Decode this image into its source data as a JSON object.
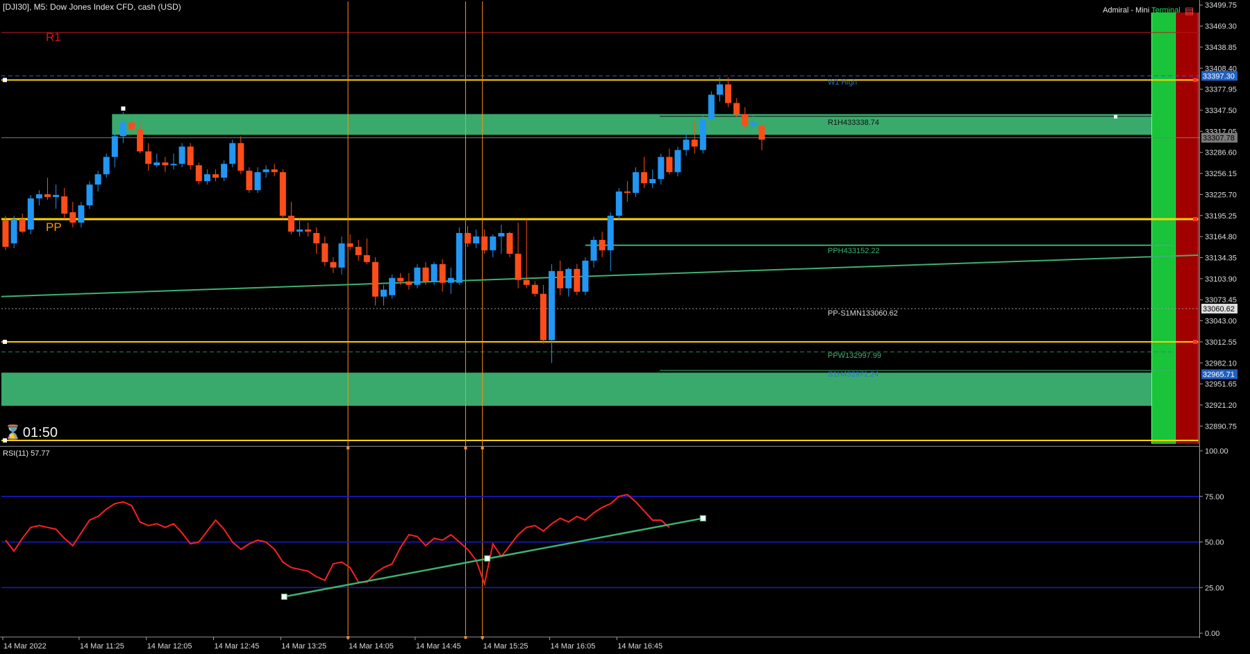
{
  "header": {
    "symbol_info": "[DJI30], M5:  Dow Jones Index CFD, cash (USD)",
    "brand_label": "Admiral - Mini ",
    "brand_terminal": "Terminal",
    "brand_icon": "chart-icon"
  },
  "timer": {
    "icon": "hourglass-icon",
    "glyph": "⌛",
    "value": "01:50"
  },
  "colors": {
    "background": "#000000",
    "bull": "#2196f3",
    "bear": "#ff4d1a",
    "zone": "#3cb371",
    "level_yellow": "#ffd400",
    "level_r1": "#c01818",
    "rsi_line": "#ff2020",
    "rsi_level": "#1a1adc",
    "trend": "#3cb371",
    "vline": "#ff9020"
  },
  "chart_data": [
    {
      "type": "candlestick",
      "symbol": "DJI30",
      "timeframe": "M5",
      "ylim": [
        32865,
        33505
      ],
      "y_ticks": [
        33499.75,
        33469.3,
        33438.85,
        33408.4,
        33377.95,
        33347.5,
        33317.05,
        33286.6,
        33256.15,
        33225.7,
        33195.25,
        33164.8,
        33134.35,
        33103.9,
        33073.45,
        33043.0,
        33012.55,
        32982.1,
        32951.65,
        32921.2,
        32890.75
      ],
      "y_tick_labels": [
        "33499.75",
        "33469.30",
        "33438.85",
        "33408.40",
        "33377.95",
        "33347.50",
        "33317.05",
        "33286.60",
        "33256.15",
        "33225.70",
        "33195.25",
        "33164.80",
        "33134.35",
        "33103.90",
        "33073.45",
        "33043.00",
        "33012.55",
        "32982.10",
        "32951.65",
        "32921.20",
        "32890.75"
      ],
      "x_labels": [
        {
          "label": "14 Mar 2022",
          "bar": 0
        },
        {
          "label": "14 Mar 11:25",
          "bar": 9
        },
        {
          "label": "14 Mar 12:05",
          "bar": 17
        },
        {
          "label": "14 Mar 12:45",
          "bar": 25
        },
        {
          "label": "14 Mar 13:25",
          "bar": 33
        },
        {
          "label": "14 Mar 14:05",
          "bar": 41
        },
        {
          "label": "14 Mar 14:45",
          "bar": 49
        },
        {
          "label": "14 Mar 15:25",
          "bar": 57
        },
        {
          "label": "14 Mar 16:05",
          "bar": 65
        },
        {
          "label": "14 Mar 16:45",
          "bar": 73
        }
      ],
      "total_bars": 115,
      "candles": [
        {
          "o": 33188,
          "h": 33195,
          "l": 33145,
          "c": 33150
        },
        {
          "o": 33155,
          "h": 33195,
          "l": 33148,
          "c": 33190
        },
        {
          "o": 33190,
          "h": 33198,
          "l": 33170,
          "c": 33172
        },
        {
          "o": 33175,
          "h": 33225,
          "l": 33168,
          "c": 33220
        },
        {
          "o": 33220,
          "h": 33232,
          "l": 33210,
          "c": 33226
        },
        {
          "o": 33226,
          "h": 33250,
          "l": 33218,
          "c": 33222
        },
        {
          "o": 33222,
          "h": 33240,
          "l": 33205,
          "c": 33225
        },
        {
          "o": 33223,
          "h": 33235,
          "l": 33190,
          "c": 33198
        },
        {
          "o": 33200,
          "h": 33215,
          "l": 33178,
          "c": 33185
        },
        {
          "o": 33185,
          "h": 33215,
          "l": 33178,
          "c": 33210
        },
        {
          "o": 33210,
          "h": 33245,
          "l": 33205,
          "c": 33240
        },
        {
          "o": 33240,
          "h": 33260,
          "l": 33230,
          "c": 33255
        },
        {
          "o": 33255,
          "h": 33285,
          "l": 33250,
          "c": 33280
        },
        {
          "o": 33280,
          "h": 33320,
          "l": 33265,
          "c": 33310
        },
        {
          "o": 33310,
          "h": 33345,
          "l": 33300,
          "c": 33330
        },
        {
          "o": 33330,
          "h": 33340,
          "l": 33315,
          "c": 33320
        },
        {
          "o": 33320,
          "h": 33330,
          "l": 33285,
          "c": 33288
        },
        {
          "o": 33288,
          "h": 33300,
          "l": 33260,
          "c": 33270
        },
        {
          "o": 33268,
          "h": 33285,
          "l": 33265,
          "c": 33272
        },
        {
          "o": 33272,
          "h": 33280,
          "l": 33258,
          "c": 33268
        },
        {
          "o": 33268,
          "h": 33285,
          "l": 33262,
          "c": 33270
        },
        {
          "o": 33270,
          "h": 33300,
          "l": 33265,
          "c": 33295
        },
        {
          "o": 33295,
          "h": 33300,
          "l": 33262,
          "c": 33268
        },
        {
          "o": 33268,
          "h": 33272,
          "l": 33240,
          "c": 33245
        },
        {
          "o": 33245,
          "h": 33262,
          "l": 33240,
          "c": 33255
        },
        {
          "o": 33255,
          "h": 33262,
          "l": 33245,
          "c": 33250
        },
        {
          "o": 33250,
          "h": 33275,
          "l": 33245,
          "c": 33270
        },
        {
          "o": 33270,
          "h": 33305,
          "l": 33265,
          "c": 33300
        },
        {
          "o": 33300,
          "h": 33310,
          "l": 33255,
          "c": 33260
        },
        {
          "o": 33260,
          "h": 33265,
          "l": 33228,
          "c": 33232
        },
        {
          "o": 33232,
          "h": 33265,
          "l": 33228,
          "c": 33258
        },
        {
          "o": 33258,
          "h": 33268,
          "l": 33250,
          "c": 33262
        },
        {
          "o": 33262,
          "h": 33270,
          "l": 33252,
          "c": 33258
        },
        {
          "o": 33258,
          "h": 33262,
          "l": 33190,
          "c": 33195
        },
        {
          "o": 33195,
          "h": 33215,
          "l": 33168,
          "c": 33172
        },
        {
          "o": 33172,
          "h": 33190,
          "l": 33165,
          "c": 33175
        },
        {
          "o": 33175,
          "h": 33185,
          "l": 33165,
          "c": 33172
        },
        {
          "o": 33170,
          "h": 33178,
          "l": 33140,
          "c": 33155
        },
        {
          "o": 33155,
          "h": 33165,
          "l": 33122,
          "c": 33128
        },
        {
          "o": 33128,
          "h": 33135,
          "l": 33112,
          "c": 33120
        },
        {
          "o": 33120,
          "h": 33165,
          "l": 33110,
          "c": 33155
        },
        {
          "o": 33155,
          "h": 33168,
          "l": 33145,
          "c": 33150
        },
        {
          "o": 33150,
          "h": 33160,
          "l": 33130,
          "c": 33138
        },
        {
          "o": 33138,
          "h": 33162,
          "l": 33125,
          "c": 33128
        },
        {
          "o": 33128,
          "h": 33135,
          "l": 33065,
          "c": 33078
        },
        {
          "o": 33078,
          "h": 33095,
          "l": 33065,
          "c": 33088
        },
        {
          "o": 33080,
          "h": 33110,
          "l": 33075,
          "c": 33105
        },
        {
          "o": 33105,
          "h": 33112,
          "l": 33095,
          "c": 33100
        },
        {
          "o": 33100,
          "h": 33112,
          "l": 33088,
          "c": 33095
        },
        {
          "o": 33095,
          "h": 33125,
          "l": 33090,
          "c": 33120
        },
        {
          "o": 33120,
          "h": 33128,
          "l": 33095,
          "c": 33100
        },
        {
          "o": 33100,
          "h": 33128,
          "l": 33095,
          "c": 33125
        },
        {
          "o": 33125,
          "h": 33132,
          "l": 33085,
          "c": 33098
        },
        {
          "o": 33098,
          "h": 33120,
          "l": 33082,
          "c": 33105
        },
        {
          "o": 33098,
          "h": 33178,
          "l": 33095,
          "c": 33170
        },
        {
          "o": 33170,
          "h": 33180,
          "l": 33150,
          "c": 33155
        },
        {
          "o": 33155,
          "h": 33175,
          "l": 33148,
          "c": 33165
        },
        {
          "o": 33165,
          "h": 33175,
          "l": 33140,
          "c": 33145
        },
        {
          "o": 33145,
          "h": 33168,
          "l": 33135,
          "c": 33165
        },
        {
          "o": 33165,
          "h": 33182,
          "l": 33140,
          "c": 33170
        },
        {
          "o": 33170,
          "h": 33172,
          "l": 33135,
          "c": 33140
        },
        {
          "o": 33140,
          "h": 33185,
          "l": 33090,
          "c": 33102
        },
        {
          "o": 33102,
          "h": 33190,
          "l": 33090,
          "c": 33095
        },
        {
          "o": 33095,
          "h": 33100,
          "l": 33078,
          "c": 33082
        },
        {
          "o": 33082,
          "h": 33095,
          "l": 33010,
          "c": 33015
        },
        {
          "o": 33015,
          "h": 33125,
          "l": 32982,
          "c": 33115
        },
        {
          "o": 33115,
          "h": 33130,
          "l": 33080,
          "c": 33090
        },
        {
          "o": 33090,
          "h": 33120,
          "l": 33078,
          "c": 33118
        },
        {
          "o": 33118,
          "h": 33125,
          "l": 33080,
          "c": 33085
        },
        {
          "o": 33085,
          "h": 33135,
          "l": 33080,
          "c": 33130
        },
        {
          "o": 33130,
          "h": 33165,
          "l": 33120,
          "c": 33160
        },
        {
          "o": 33160,
          "h": 33172,
          "l": 33135,
          "c": 33145
        },
        {
          "o": 33145,
          "h": 33200,
          "l": 33115,
          "c": 33195
        },
        {
          "o": 33195,
          "h": 33235,
          "l": 33188,
          "c": 33230
        },
        {
          "o": 33230,
          "h": 33245,
          "l": 33215,
          "c": 33228
        },
        {
          "o": 33228,
          "h": 33265,
          "l": 33222,
          "c": 33258
        },
        {
          "o": 33258,
          "h": 33280,
          "l": 33235,
          "c": 33242
        },
        {
          "o": 33242,
          "h": 33262,
          "l": 33235,
          "c": 33248
        },
        {
          "o": 33248,
          "h": 33285,
          "l": 33240,
          "c": 33280
        },
        {
          "o": 33280,
          "h": 33292,
          "l": 33255,
          "c": 33258
        },
        {
          "o": 33258,
          "h": 33295,
          "l": 33252,
          "c": 33290
        },
        {
          "o": 33290,
          "h": 33315,
          "l": 33282,
          "c": 33305
        },
        {
          "o": 33305,
          "h": 33330,
          "l": 33285,
          "c": 33295
        },
        {
          "o": 33290,
          "h": 33340,
          "l": 33285,
          "c": 33335
        },
        {
          "o": 33335,
          "h": 33375,
          "l": 33330,
          "c": 33370
        },
        {
          "o": 33370,
          "h": 33395,
          "l": 33360,
          "c": 33385
        },
        {
          "o": 33385,
          "h": 33395,
          "l": 33352,
          "c": 33358
        },
        {
          "o": 33358,
          "h": 33365,
          "l": 33338,
          "c": 33342
        },
        {
          "o": 33342,
          "h": 33352,
          "l": 33318,
          "c": 33325
        },
        {
          "o": 33325,
          "h": 33340,
          "l": 33322,
          "c": 33330
        },
        {
          "o": 33325,
          "h": 33330,
          "l": 33290,
          "c": 33305
        }
      ],
      "levels": [
        {
          "name": "R1",
          "price": 33460,
          "label": "R1"
        },
        {
          "name": "W1 High",
          "price": 33397.3,
          "label": "W1 High",
          "badge": "33397.30"
        },
        {
          "name": "PP",
          "price": 33190,
          "label": "PP"
        },
        {
          "name": "R1H4",
          "price": 33338.74,
          "label": "R1H433338.74"
        },
        {
          "name": "PPH4",
          "price": 33152.22,
          "label": "PPH433152.22"
        },
        {
          "name": "PP-S1MN1",
          "price": 33060.62,
          "label": "PP-S1MN133060.62",
          "badge": "33060.62"
        },
        {
          "name": "PPW1",
          "price": 32997.99,
          "label": "PPW132997.99"
        },
        {
          "name": "S1H4",
          "price": 32971.24,
          "label": "S1H432971.24",
          "badge": "32965.71"
        },
        {
          "name": "current",
          "price": 33307.78,
          "badge": "33307.78"
        },
        {
          "name": "yellow_low",
          "price": 33012.55
        },
        {
          "name": "yellow_bottom",
          "price": 32870
        }
      ],
      "zones": [
        {
          "from_bar": 13,
          "top": 33342,
          "bottom": 33312
        },
        {
          "from_bar": 0,
          "top": 32968,
          "bottom": 32920
        }
      ],
      "trendline": {
        "bar1": 0,
        "p1": 33078,
        "bar2": 115,
        "p2": 33138
      },
      "vlines_bars": [
        41,
        55,
        57
      ]
    },
    {
      "type": "line",
      "title": "RSI(11) 57.77",
      "period": 11,
      "current": 57.77,
      "ylim": [
        0,
        100
      ],
      "y_ticks": [
        100,
        75,
        50,
        25,
        0
      ],
      "y_tick_labels": [
        "100.00",
        "75.00",
        "50.00",
        "25.00",
        "0.00"
      ],
      "levels": [
        75,
        50,
        25
      ],
      "values": [
        51,
        45,
        52,
        58,
        59,
        58,
        57,
        52,
        48,
        55,
        62,
        64,
        68,
        71,
        72,
        70,
        61,
        59,
        60,
        58,
        60,
        55,
        49,
        50,
        56,
        62,
        57,
        50,
        46,
        49,
        51,
        50,
        46,
        39,
        36,
        35,
        34,
        31,
        29,
        38,
        39,
        36,
        28,
        28,
        33,
        36,
        38,
        47,
        54,
        53,
        48,
        52,
        51,
        54,
        50,
        46,
        40,
        27,
        49,
        42,
        48,
        54,
        58,
        59,
        56,
        60,
        63,
        61,
        64,
        62,
        66,
        69,
        71,
        75,
        76,
        72,
        67,
        62,
        62,
        58
      ],
      "trendline": {
        "bar1": 33,
        "v1": 20,
        "bar2": 83,
        "v2": 63
      }
    }
  ]
}
